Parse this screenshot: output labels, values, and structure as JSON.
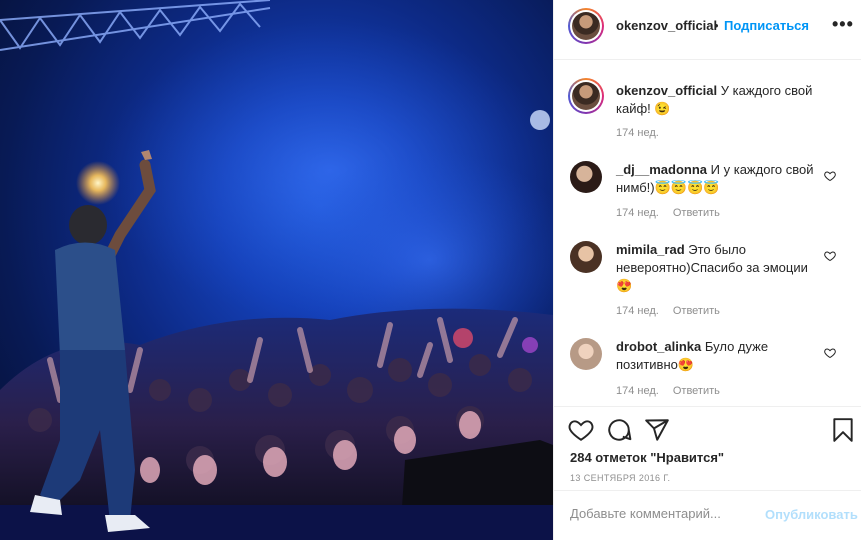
{
  "post": {
    "author": "okenzov_official",
    "follow_label": "Подписаться",
    "separator": "•",
    "more": "•••"
  },
  "caption": {
    "username": "okenzov_official",
    "text": "У каждого свой кайф! 😉",
    "time": "174 нед."
  },
  "comments": [
    {
      "username": "_dj__madonna",
      "text": "И у каждого свой нимб!)😇😇😇😇",
      "time": "174 нед.",
      "reply": "Ответить"
    },
    {
      "username": "mimila_rad",
      "text": "Это было невероятно)Спасибо за эмоции 😍",
      "time": "174 нед.",
      "reply": "Ответить"
    },
    {
      "username": "drobot_alinka",
      "text": "Було дуже позитивно😍",
      "time": "174 нед.",
      "reply": "Ответить"
    }
  ],
  "likes": "284 отметок \"Нравится\"",
  "date": "13 СЕНТЯБРЯ 2016 Г.",
  "add_comment": {
    "placeholder": "Добавьте комментарий...",
    "publish": "Опубликовать"
  },
  "icons": {
    "like": "heart-icon",
    "comment": "comment-icon",
    "share": "share-icon",
    "save": "bookmark-icon"
  },
  "colors": {
    "accent": "#0095f6",
    "publish_disabled": "#b2dffc",
    "muted": "#8e8e8e"
  }
}
